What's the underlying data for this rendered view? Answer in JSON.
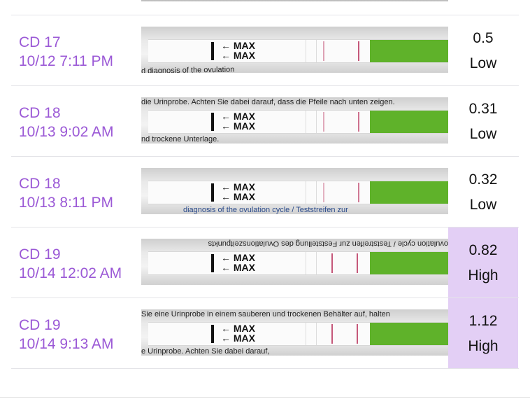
{
  "colors": {
    "accent": "#9b59d6",
    "high_bg": "#e3cff5",
    "strip_green": "#5fb22a",
    "test_line": "#c5587a"
  },
  "strip_marker": "MAX",
  "rows": [
    {
      "cycle_day": "CD 17",
      "datetime": "10/12 7:11 PM",
      "value": "0.5",
      "level": "Low",
      "print_top": "",
      "print_bottom": "d diagnosis of the ovulation"
    },
    {
      "cycle_day": "CD 18",
      "datetime": "10/13 9:02 AM",
      "value": "0.31",
      "level": "Low",
      "print_top": "die Urinprobe. Achten Sie dabei darauf, dass die Pfeile nach unten zeigen.",
      "print_bottom": "nd trockene Unterlage."
    },
    {
      "cycle_day": "CD 18",
      "datetime": "10/13 8:11 PM",
      "value": "0.32",
      "level": "Low",
      "print_top": "",
      "print_bottom": "diagnosis of the ovulation cycle / Teststreifen zur"
    },
    {
      "cycle_day": "CD 19",
      "datetime": "10/14 12:02 AM",
      "value": "0.82",
      "level": "High",
      "print_top": "ovulation cycle / Teststreifen zur Feststellung des Ovulationszeitpunkts",
      "print_bottom": ""
    },
    {
      "cycle_day": "CD 19",
      "datetime": "10/14 9:13 AM",
      "value": "1.12",
      "level": "High",
      "print_top": "Sie eine Urinprobe in einem sauberen und trockenen Behälter auf, halten",
      "print_bottom": "e Urinprobe. Achten Sie dabei darauf,"
    }
  ]
}
